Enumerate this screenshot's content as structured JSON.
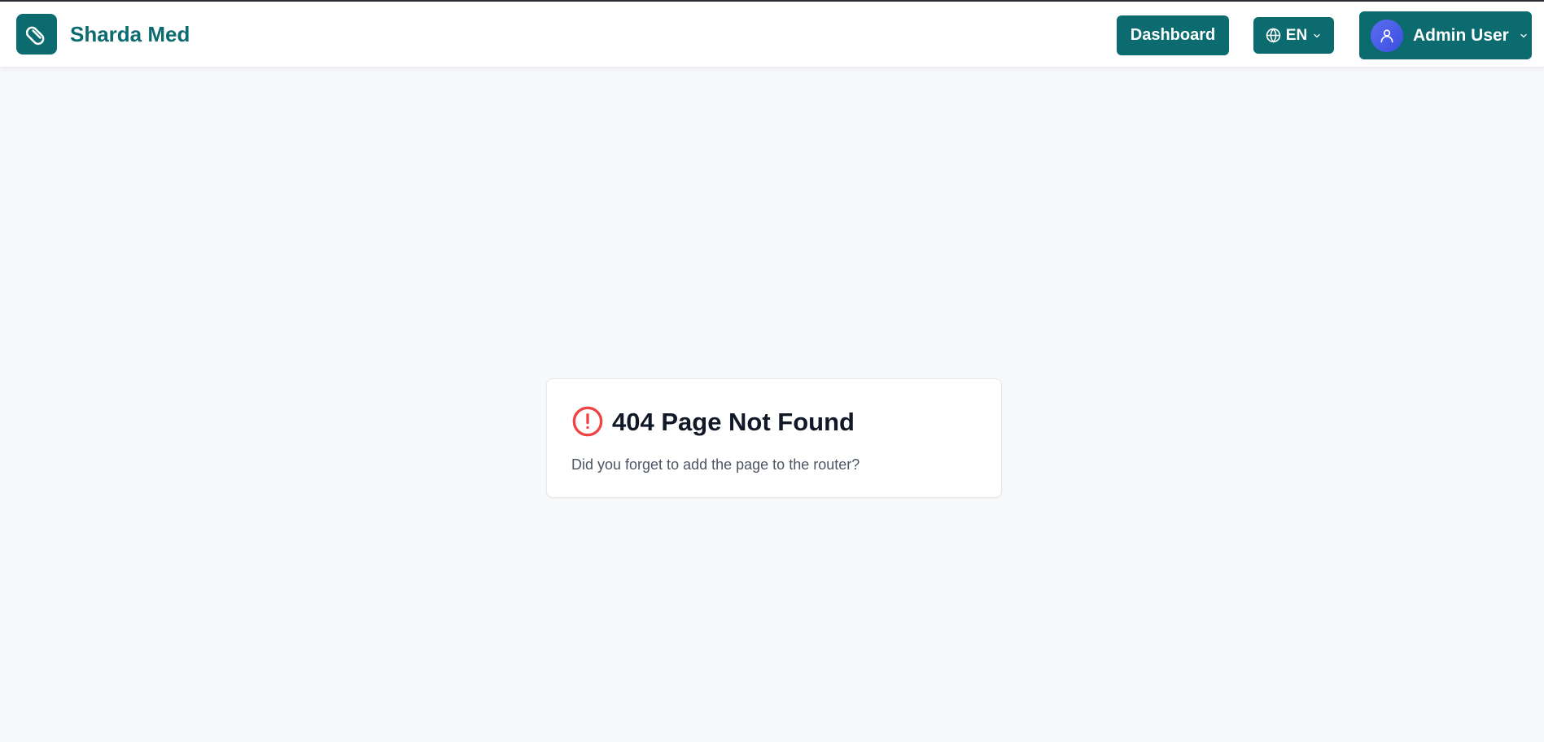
{
  "brand": {
    "name": "Sharda Med",
    "logo_icon": "pill-icon",
    "color": "#0b6b6f"
  },
  "header": {
    "dashboard_label": "Dashboard",
    "language": {
      "label": "EN",
      "icon": "globe-icon"
    },
    "user": {
      "name": "Admin User",
      "avatar_icon": "user-icon"
    }
  },
  "not_found": {
    "title": "404 Page Not Found",
    "description": "Did you forget to add the page to the router?",
    "icon": "alert-circle-icon",
    "icon_color": "#ef4444"
  }
}
